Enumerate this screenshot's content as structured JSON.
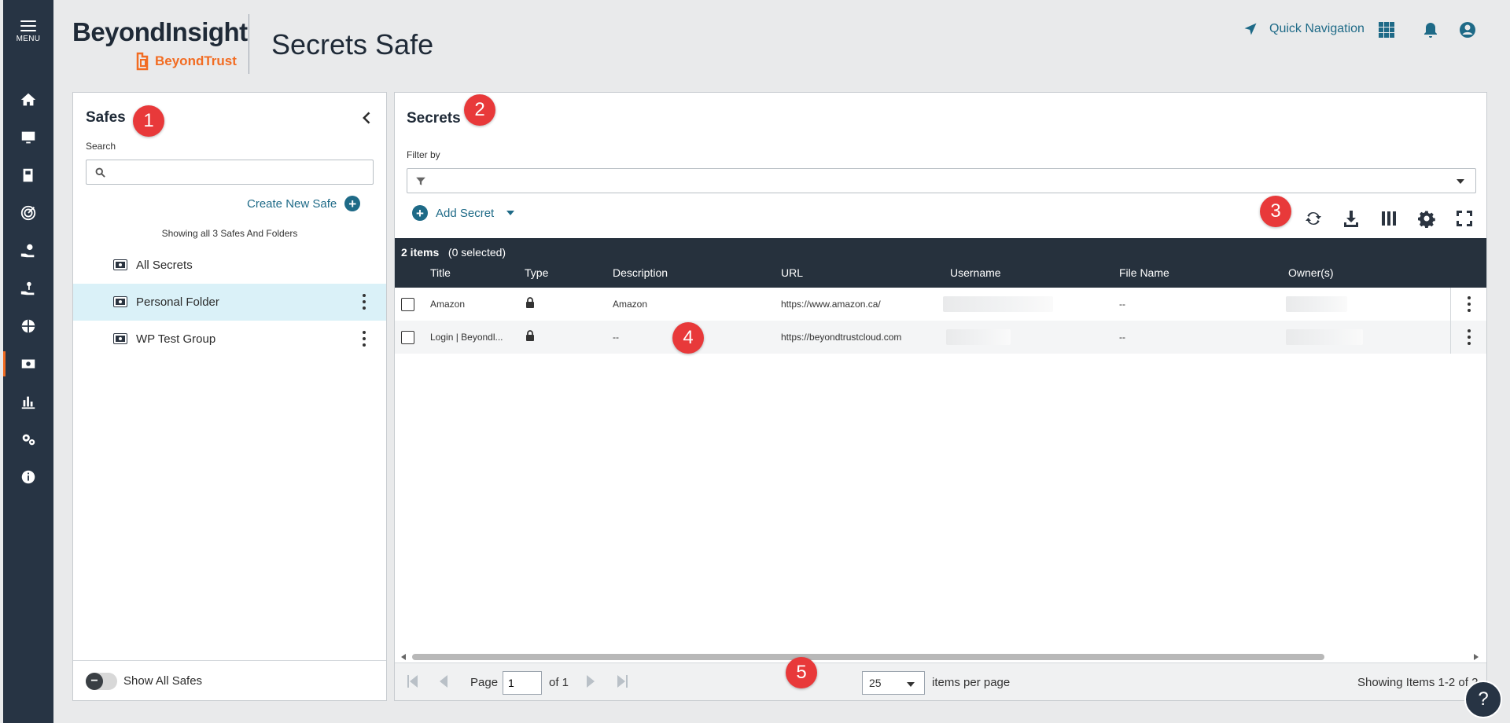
{
  "nav": {
    "menu_label": "MENU",
    "items": [
      "home",
      "assets",
      "smart-rules",
      "analytics",
      "delegation",
      "password-safe",
      "discovery",
      "secrets-safe",
      "reports",
      "configuration",
      "about"
    ]
  },
  "header": {
    "brand": "BeyondInsight",
    "brand_sub": "BeyondTrust",
    "title": "Secrets Safe",
    "quick_nav": "Quick Navigation"
  },
  "colors": {
    "accent": "#1e6a87",
    "brand_orange": "#f26c22",
    "nav_bg": "#273444",
    "badge": "#e8393a",
    "selected_row": "#daf1f8"
  },
  "safes": {
    "title": "Safes",
    "badge": "1",
    "search_label": "Search",
    "search_placeholder": "",
    "create_label": "Create New Safe",
    "showing": "Showing all 3 Safes And Folders",
    "items": [
      {
        "name": "All Secrets"
      },
      {
        "name": "Personal Folder"
      },
      {
        "name": "WP Test Group"
      }
    ],
    "show_all_label": "Show All Safes"
  },
  "secrets": {
    "title": "Secrets",
    "badge": "2",
    "filter_label": "Filter by",
    "add_label": "Add Secret",
    "toolbar_badge": "3",
    "row_badge": "4",
    "pager_badge": "5",
    "grid": {
      "count_bold": "2 items",
      "count_rest": "(0 selected)",
      "columns": [
        "Title",
        "Type",
        "Description",
        "URL",
        "Username",
        "File Name",
        "Owner(s)"
      ],
      "rows": [
        {
          "title": "Amazon",
          "description": "Amazon",
          "url": "https://www.amazon.ca/",
          "file_name": "--"
        },
        {
          "title": "Login | Beyondl...",
          "description": "--",
          "url": "https://beyondtrustcloud.com",
          "file_name": "--"
        }
      ]
    },
    "pager": {
      "page_label": "Page",
      "page_value": "1",
      "of_label": "of 1",
      "per_page_value": "25",
      "per_page_label": "items per page",
      "showing": "Showing Items 1-2 of 2"
    }
  }
}
